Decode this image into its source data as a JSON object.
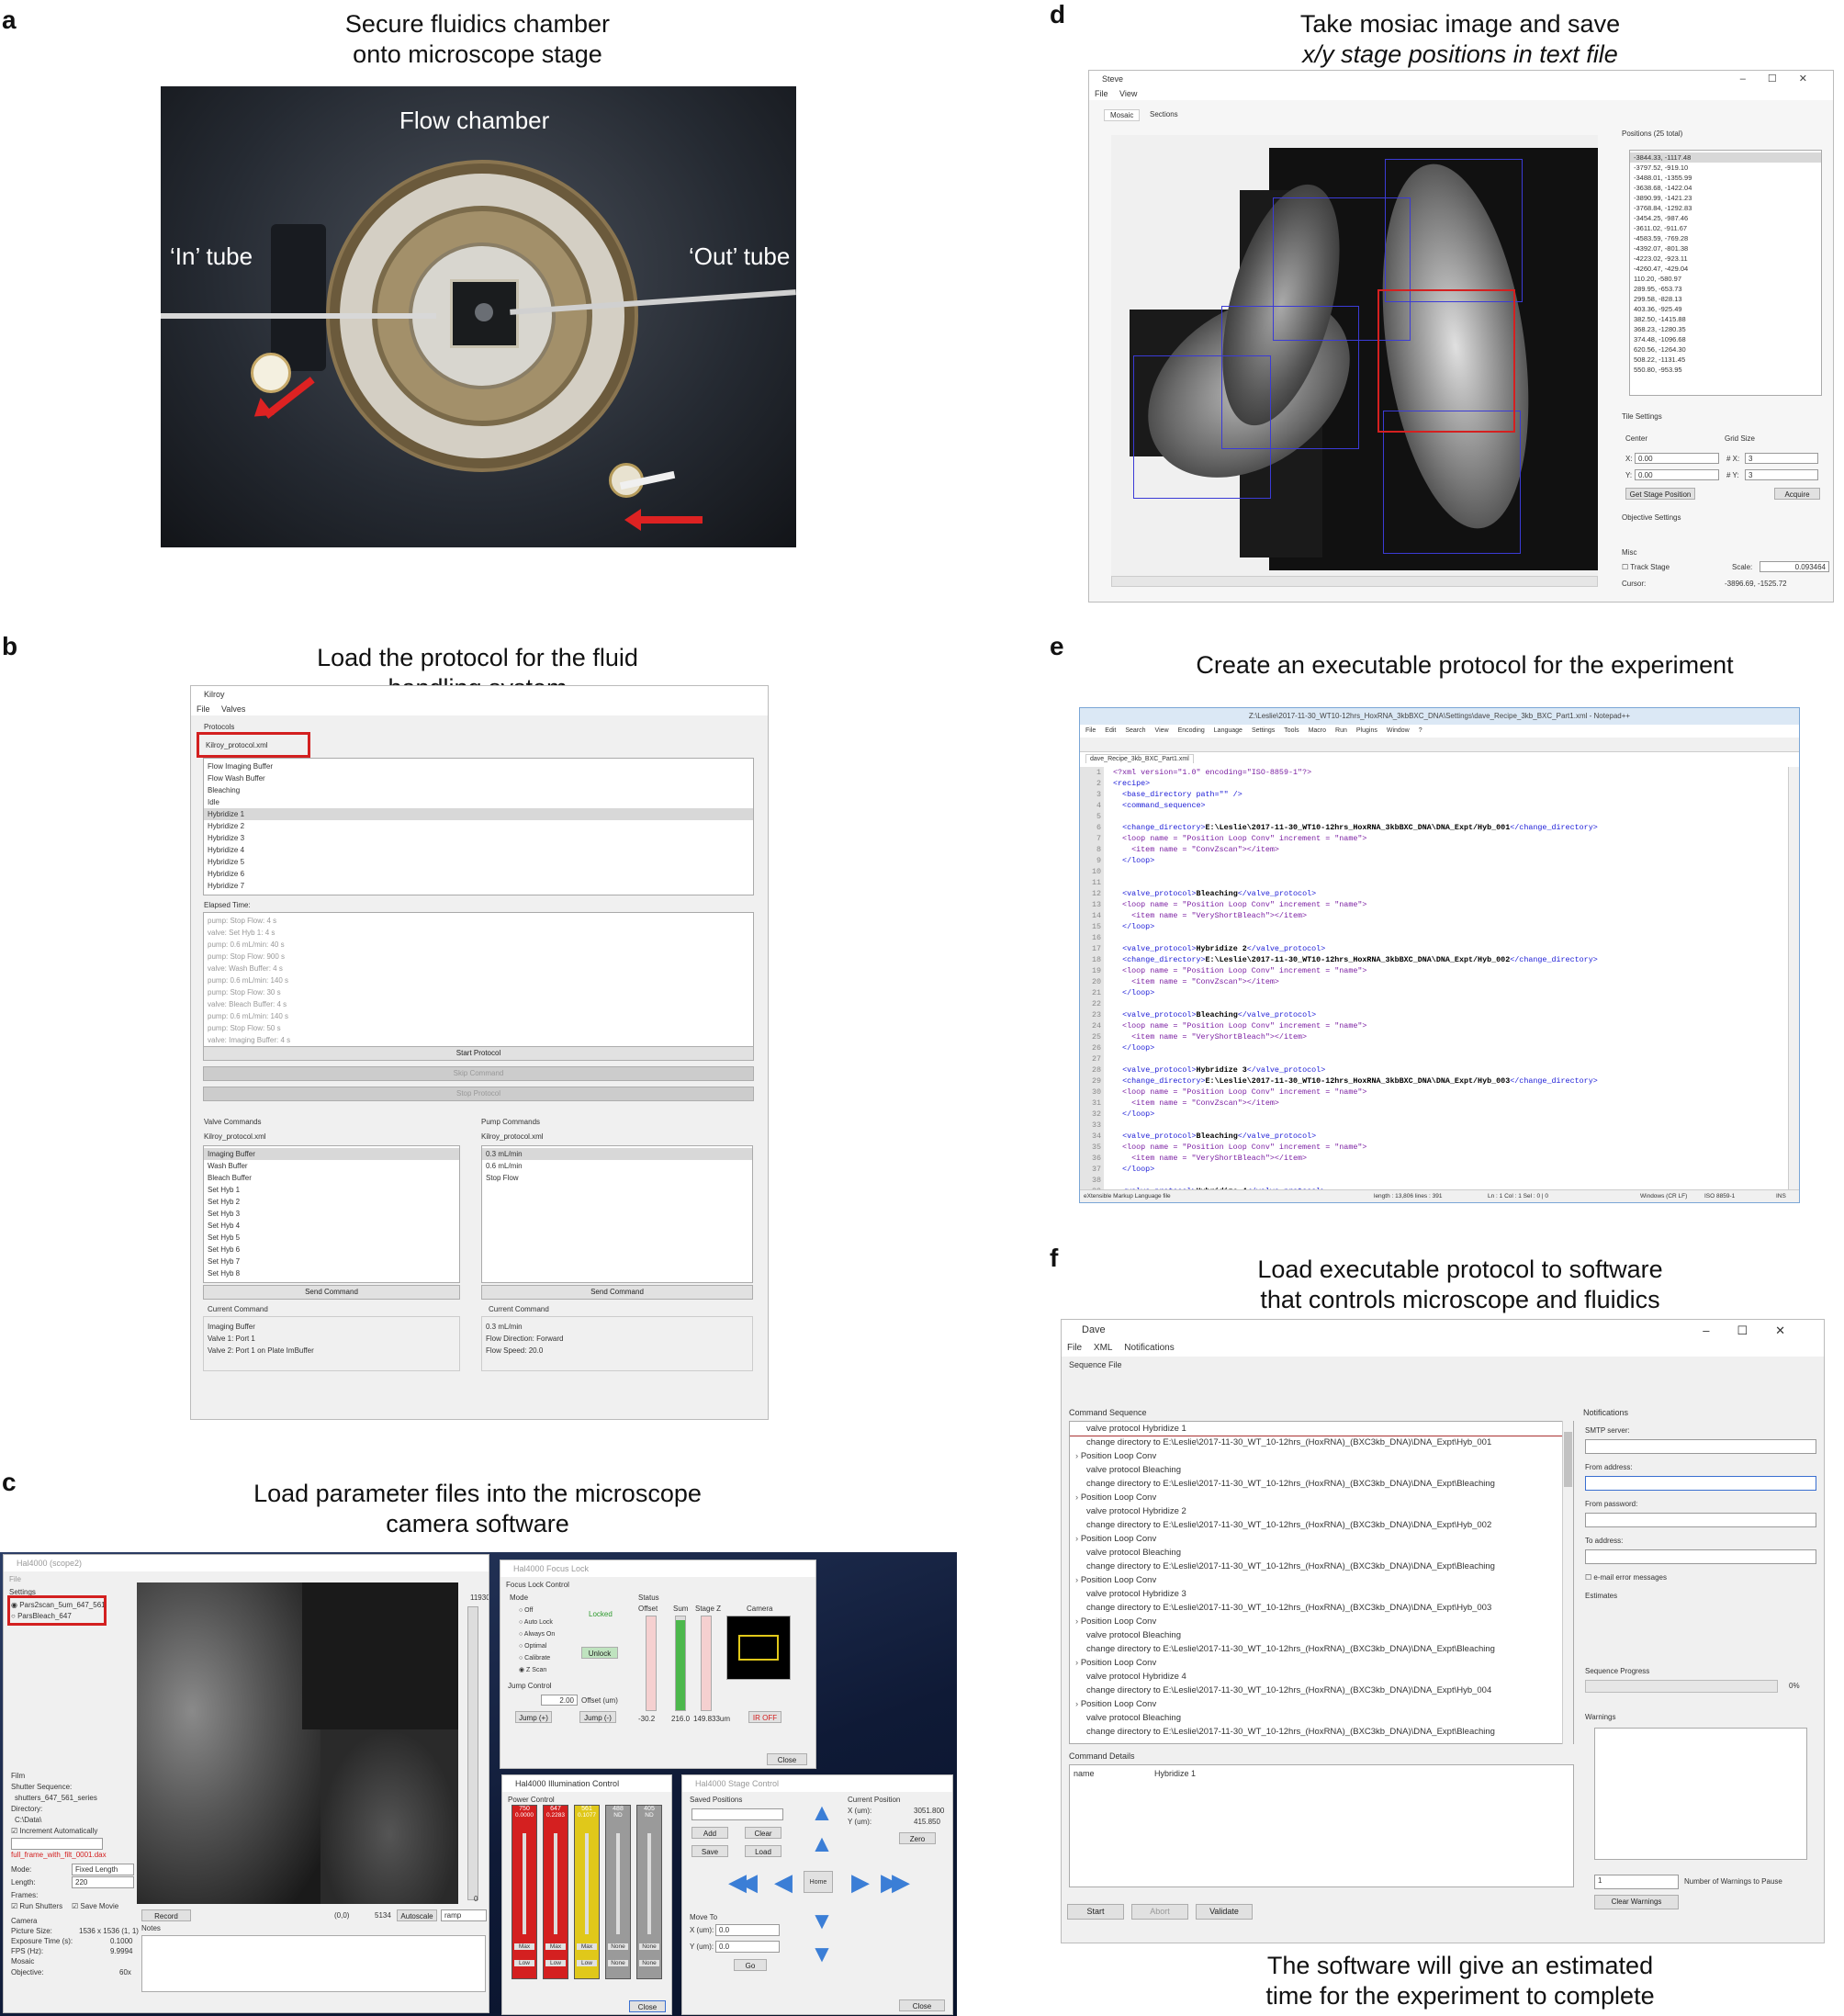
{
  "panels": {
    "a": {
      "label": "a",
      "caption": [
        "Secure fluidics chamber",
        "onto microscope stage"
      ],
      "photo_labels": {
        "flow": "Flow chamber",
        "in": "‘In’ tube",
        "out": "‘Out’ tube"
      }
    },
    "b": {
      "label": "b",
      "caption": [
        "Load the protocol for the fluid",
        "handling system"
      ],
      "window": {
        "title": "Kilroy",
        "menu": [
          "File",
          "Valves"
        ],
        "protocols_label": "Protocols",
        "protocol_file": "Kilroy_protocol.xml",
        "protocols": [
          "Flow Imaging Buffer",
          "Flow Wash Buffer",
          "Bleaching",
          "Idle",
          "Hybridize 1",
          "Hybridize 2",
          "Hybridize 3",
          "Hybridize 4",
          "Hybridize 5",
          "Hybridize 6",
          "Hybridize 7"
        ],
        "elapsed_label": "Elapsed Time:",
        "elapsed": [
          "pump: Stop Flow: 4 s",
          "valve: Set Hyb 1: 4 s",
          "pump: 0.6 mL/min: 40 s",
          "pump: Stop Flow: 900 s",
          "valve: Wash Buffer: 4 s",
          "pump: 0.6 mL/min: 140 s",
          "pump: Stop Flow: 30 s",
          "valve: Bleach Buffer: 4 s",
          "pump: 0.6 mL/min: 140 s",
          "pump: Stop Flow: 50 s",
          "valve: Imaging Buffer: 4 s"
        ],
        "start": "Start Protocol",
        "skip": "Skip Command",
        "stop": "Stop Protocol",
        "valve_title": "Valve Commands",
        "pump_title": "Pump Commands",
        "valve_file": "Kilroy_protocol.xml",
        "pump_file": "Kilroy_protocol.xml",
        "valves": [
          "Imaging Buffer",
          "Wash Buffer",
          "Bleach Buffer",
          "Set Hyb 1",
          "Set Hyb 2",
          "Set Hyb 3",
          "Set Hyb 4",
          "Set Hyb 5",
          "Set Hyb 6",
          "Set Hyb 7",
          "Set Hyb 8"
        ],
        "pumps": [
          "0.3 mL/min",
          "0.6 mL/min",
          "Stop Flow"
        ],
        "send": "Send Command",
        "current": "Current Command",
        "valve_current": [
          "Imaging Buffer",
          "Valve 1: Port 1",
          "Valve 2: Port 1 on Plate ImBuffer"
        ],
        "pump_current": [
          "0.3 mL/min",
          "Flow Direction: Forward",
          "Flow Speed: 20.0"
        ]
      }
    },
    "c": {
      "label": "c",
      "caption": [
        "Load parameter files into the microscope",
        "camera software"
      ],
      "hal": {
        "title": "Hal4000 (scope2)",
        "menu": "File",
        "settings_label": "Settings",
        "settings": [
          "Par‌s2scan_5um_647_561",
          "ParsBleach_647"
        ],
        "film_label": "Film",
        "shutter_label": "Shutter Sequence:",
        "shutter_value": "shutters_647_561_series",
        "dir_label": "Directory:",
        "dir_value": "C:\\Data\\",
        "increment": "Increment Automatically",
        "filename": "full_frame_with_filt_0001.dax",
        "mode_label": "Mode:",
        "mode_value": "Fixed Length",
        "length_label": "Length:",
        "length_value": "220",
        "frames_label": "Frames:",
        "run_shutters": "Run Shutters",
        "save_movie": "Save Movie",
        "camera_label": "Camera",
        "picture_size": "Picture Size:",
        "picture_size_value": "1536 x 1536 (1, 1)",
        "exposure": "Exposure Time (s):",
        "exposure_value": "0.1000",
        "fps": "FPS (Hz):",
        "fps_value": "9.9994",
        "mosaic": "Mosaic",
        "objective": "Objective:",
        "objective_value": "60x",
        "record": "Record",
        "notes": "Notes",
        "coords": "(0,0)",
        "intensity": "5134",
        "autoscale": "Autoscale",
        "colormap": "ramp",
        "range_max": "11930",
        "range_min": "0"
      },
      "focus": {
        "title": "Hal4000 Focus Lock",
        "group": "Focus Lock Control",
        "mode": "Mode",
        "modes": [
          "Off",
          "Auto Lock",
          "Always On",
          "Optimal",
          "Calibrate",
          "Z Scan"
        ],
        "locked": "Locked",
        "unlock": "Unlock",
        "status": "Status",
        "offset": "Offset",
        "sum": "Sum",
        "stage": "Stage Z",
        "camera": "Camera",
        "jump": "Jump Control",
        "jump_value": "2.00",
        "offset_um": "Offset (um)",
        "jump_plus": "Jump (+)",
        "jump_minus": "Jump (-)",
        "offset_val": "-30.2",
        "sum_val": "216.0",
        "stage_val": "149.833um",
        "ir": "IR OFF",
        "close": "Close"
      },
      "illum": {
        "title": "Hal4000 Illumination Control",
        "power": "Power Control",
        "channels": [
          {
            "name": "750",
            "val": "0.0000",
            "color": "#d42020"
          },
          {
            "name": "647",
            "val": "0.2283",
            "color": "#d42020"
          },
          {
            "name": "561",
            "val": "0.1077",
            "color": "#e0c81a"
          },
          {
            "name": "488",
            "val": "ND",
            "color": "#9a9a9a"
          },
          {
            "name": "405",
            "val": "ND",
            "color": "#9a9a9a"
          }
        ],
        "max": "Max",
        "low": "Low",
        "none": "None",
        "close": "Close"
      },
      "stage": {
        "title": "Hal4000 Stage Control",
        "saved": "Saved Positions",
        "add": "Add",
        "clear": "Clear",
        "save": "Save",
        "load": "Load",
        "current": "Current Position",
        "x_label": "X (um):",
        "x_val": "3051.800",
        "y_label": "Y (um):",
        "y_val": "415.850",
        "zero": "Zero",
        "home": "Home",
        "move_to": "Move To",
        "mx": "X (um):",
        "my": "Y (um):",
        "mx_val": "0.0",
        "my_val": "0.0",
        "go": "Go",
        "close": "Close"
      }
    },
    "d": {
      "label": "d",
      "caption": [
        "Take mosiac image and save",
        "x/y stage positions in text file"
      ],
      "window": {
        "title": "Steve",
        "menu": [
          "File",
          "View"
        ],
        "tabs": [
          "Mosaic",
          "Sections"
        ],
        "positions_label": "Positions (25 total)",
        "positions": [
          "-3844.33, -1117.48",
          "-3797.52, -919.10",
          "-3488.01, -1355.99",
          "-3638.68, -1422.04",
          "-3890.99, -1421.23",
          "-3768.84, -1292.83",
          "-3454.25, -987.46",
          "-3611.02, -911.67",
          "-4583.59, -769.28",
          "-4392.07, -801.38",
          "-4223.02, -923.11",
          "-4260.47, -429.04",
          "110.20, -580.97",
          "289.95, -653.73",
          "299.58, -828.13",
          "403.36, -925.49",
          "382.50, -1415.88",
          "368.23, -1280.35",
          "374.48, -1096.68",
          "620.56, -1264.30",
          "508.22, -1131.45",
          "550.80, -953.95"
        ],
        "tile_settings": "Tile Settings",
        "center": "Center",
        "grid_size": "Grid Size",
        "x_label": "X:",
        "y_label": "Y:",
        "x_val": "0.00",
        "y_val": "0.00",
        "nx_label": "# X:",
        "ny_label": "# Y:",
        "nx_val": "3",
        "ny_val": "3",
        "get_stage": "Get Stage Position",
        "acquire": "Acquire",
        "objective_settings": "Objective Settings",
        "misc": "Misc",
        "track": "Track Stage",
        "scale_label": "Scale:",
        "scale_val": "0.093464",
        "cursor_label": "Cursor:",
        "cursor_val": "-3896.69, -1525.72"
      }
    },
    "e": {
      "label": "e",
      "caption": [
        "Create an executable protocol for the experiment"
      ],
      "window": {
        "title": "Z:\\Leslie\\2017-11-30_WT10-12hrs_HoxRNA_3kbBXC_DNA\\Settings\\dave_Recipe_3kb_BXC_Part1.xml - Notepad++",
        "menu": [
          "File",
          "Edit",
          "Search",
          "View",
          "Encoding",
          "Language",
          "Settings",
          "Tools",
          "Macro",
          "Run",
          "Plugins",
          "Window",
          "?"
        ],
        "tab": "dave_Recipe_3kb_BXC_Part1.xml",
        "lines": [
          "<?xml version=\"1.0\" encoding=\"ISO-8859-1\"?>",
          "<recipe>",
          "  <base_directory path=\"\" />",
          "  <command_sequence>",
          "",
          "  <change_directory>E:\\Leslie\\2017-11-30_WT10-12hrs_HoxRNA_3kbBXC_DNA\\DNA_Expt/Hyb_001</change_directory>",
          "  <loop name = \"Position Loop Conv\" increment = \"name\">",
          "    <item name = \"ConvZscan\"></item>",
          "  </loop>",
          "",
          "",
          "  <valve_protocol>Bleaching</valve_protocol>",
          "  <loop name = \"Position Loop Conv\" increment = \"name\">",
          "    <item name = \"VeryShortBleach\"></item>",
          "  </loop>",
          "",
          "  <valve_protocol>Hybridize 2</valve_protocol>",
          "  <change_directory>E:\\Leslie\\2017-11-30_WT10-12hrs_HoxRNA_3kbBXC_DNA\\DNA_Expt/Hyb_002</change_directory>",
          "  <loop name = \"Position Loop Conv\" increment = \"name\">",
          "    <item name = \"ConvZscan\"></item>",
          "  </loop>",
          "",
          "  <valve_protocol>Bleaching</valve_protocol>",
          "  <loop name = \"Position Loop Conv\" increment = \"name\">",
          "    <item name = \"VeryShortBleach\"></item>",
          "  </loop>",
          "",
          "  <valve_protocol>Hybridize 3</valve_protocol>",
          "  <change_directory>E:\\Leslie\\2017-11-30_WT10-12hrs_HoxRNA_3kbBXC_DNA\\DNA_Expt/Hyb_003</change_directory>",
          "  <loop name = \"Position Loop Conv\" increment = \"name\">",
          "    <item name = \"ConvZscan\"></item>",
          "  </loop>",
          "",
          "  <valve_protocol>Bleaching</valve_protocol>",
          "  <loop name = \"Position Loop Conv\" increment = \"name\">",
          "    <item name = \"VeryShortBleach\"></item>",
          "  </loop>",
          "",
          "  <valve_protocol>Hybridize 4</valve_protocol>"
        ],
        "status_left": "eXtensible Markup Language file",
        "status_len": "length : 13,806    lines : 391",
        "status_pos": "Ln : 1    Col : 1    Sel : 0 | 0",
        "status_eol": "Windows (CR LF)",
        "status_enc": "ISO 8859-1",
        "status_ins": "INS"
      }
    },
    "f": {
      "label": "f",
      "caption": [
        "Load executable protocol to software",
        "that controls microscope and fluidics"
      ],
      "caption2": [
        "The software will give an estimated",
        "time for the experiment to complete"
      ],
      "window": {
        "title": "Dave",
        "menu": [
          "File",
          "XML",
          "Notifications"
        ],
        "sequence_file": "Sequence File",
        "command_sequence": "Command Sequence",
        "commands": [
          {
            "t": "valve protocol Hybridize 1",
            "exp": false,
            "sel": true
          },
          {
            "t": "change directory to E:\\Leslie\\2017-11-30_WT_10-12hrs_(HoxRNA)_(BXC3kb_DNA)\\DNA_Expt\\Hyb_001",
            "exp": false
          },
          {
            "t": "Position Loop Conv",
            "exp": true
          },
          {
            "t": "valve protocol Bleaching",
            "exp": false
          },
          {
            "t": "change directory to E:\\Leslie\\2017-11-30_WT_10-12hrs_(HoxRNA)_(BXC3kb_DNA)\\DNA_Expt\\Bleaching",
            "exp": false
          },
          {
            "t": "Position Loop Conv",
            "exp": true
          },
          {
            "t": "valve protocol Hybridize 2",
            "exp": false
          },
          {
            "t": "change directory to E:\\Leslie\\2017-11-30_WT_10-12hrs_(HoxRNA)_(BXC3kb_DNA)\\DNA_Expt\\Hyb_002",
            "exp": false
          },
          {
            "t": "Position Loop Conv",
            "exp": true
          },
          {
            "t": "valve protocol Bleaching",
            "exp": false
          },
          {
            "t": "change directory to E:\\Leslie\\2017-11-30_WT_10-12hrs_(HoxRNA)_(BXC3kb_DNA)\\DNA_Expt\\Bleaching",
            "exp": false
          },
          {
            "t": "Position Loop Conv",
            "exp": true
          },
          {
            "t": "valve protocol Hybridize 3",
            "exp": false
          },
          {
            "t": "change directory to E:\\Leslie\\2017-11-30_WT_10-12hrs_(HoxRNA)_(BXC3kb_DNA)\\DNA_Expt\\Hyb_003",
            "exp": false
          },
          {
            "t": "Position Loop Conv",
            "exp": true
          },
          {
            "t": "valve protocol Bleaching",
            "exp": false
          },
          {
            "t": "change directory to E:\\Leslie\\2017-11-30_WT_10-12hrs_(HoxRNA)_(BXC3kb_DNA)\\DNA_Expt\\Bleaching",
            "exp": false
          },
          {
            "t": "Position Loop Conv",
            "exp": true
          },
          {
            "t": "valve protocol Hybridize 4",
            "exp": false
          },
          {
            "t": "change directory to E:\\Leslie\\2017-11-30_WT_10-12hrs_(HoxRNA)_(BXC3kb_DNA)\\DNA_Expt\\Hyb_004",
            "exp": false
          },
          {
            "t": "Position Loop Conv",
            "exp": true
          },
          {
            "t": "valve protocol Bleaching",
            "exp": false
          },
          {
            "t": "change directory to E:\\Leslie\\2017-11-30_WT_10-12hrs_(HoxRNA)_(BXC3kb_DNA)\\DNA_Expt\\Bleaching",
            "exp": false
          }
        ],
        "details": "Command Details",
        "detail_name": "name",
        "detail_value": "Hybridize 1",
        "start": "Start",
        "abort": "Abort",
        "validate": "Validate",
        "notifications": "Notifications",
        "smtp": "SMTP server:",
        "from_addr": "From address:",
        "from_pw": "From password:",
        "to_addr": "To address:",
        "email_err": "e-mail error messages",
        "estimates": "Estimates",
        "progress": "Sequence Progress",
        "progress_pct": "0%",
        "progress_value": 0,
        "warnings": "Warnings",
        "warn_count": "1",
        "warn_label": "Number of Warnings  to Pause",
        "clear_warn": "Clear Warnings"
      }
    }
  }
}
